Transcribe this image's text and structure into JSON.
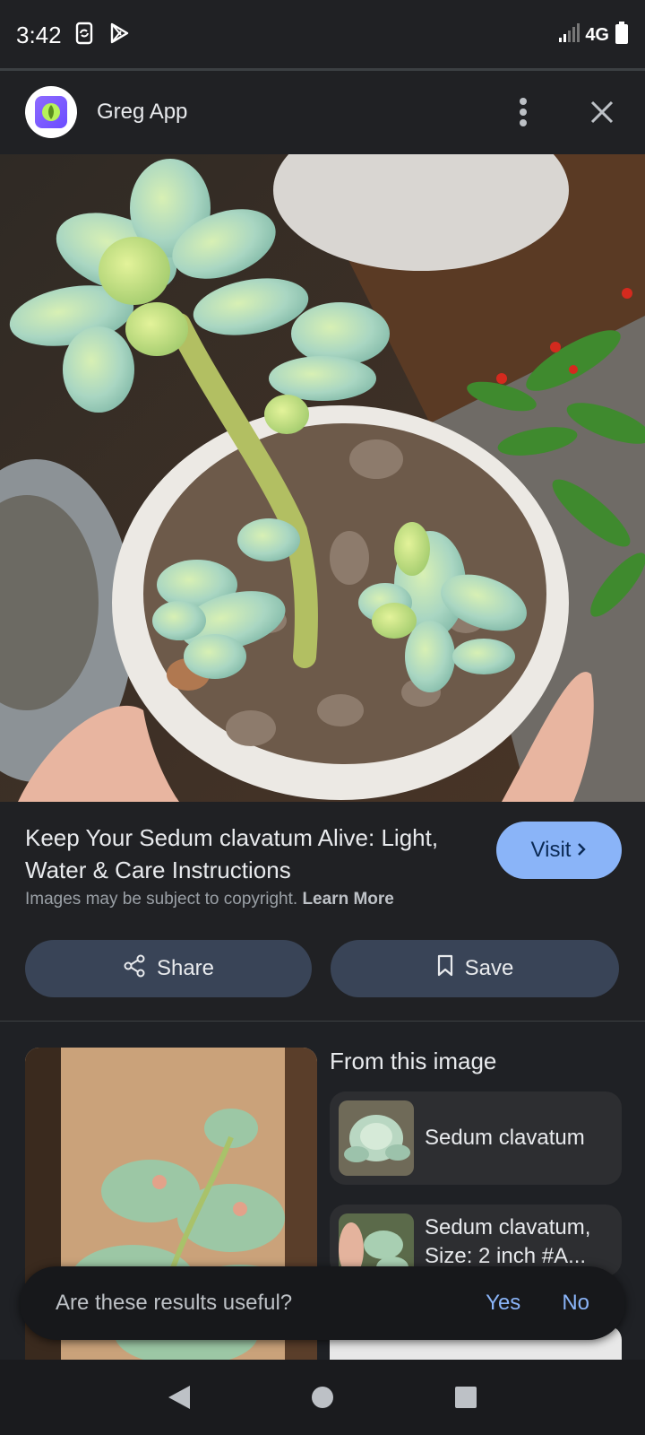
{
  "status_bar": {
    "time": "3:42",
    "network": "4G",
    "icons": [
      "sync-icon",
      "play-store-icon",
      "signal-icon",
      "battery-icon"
    ]
  },
  "header": {
    "app_name": "Greg App",
    "icons": [
      "greg-app-logo-icon",
      "more-vert-icon",
      "close-icon"
    ]
  },
  "result": {
    "title": "Keep Your Sedum clavatum Alive: Light, Water & Care Instructions",
    "visit_label": "Visit",
    "copyright_text": "Images may be subject to copyright.",
    "learn_more": "Learn More",
    "share_label": "Share",
    "save_label": "Save"
  },
  "from_image": {
    "heading": "From this image",
    "items": [
      {
        "label": "Sedum clavatum"
      },
      {
        "label": "Sedum clavatum, Size: 2 inch #A..."
      }
    ]
  },
  "feedback": {
    "question": "Are these results useful?",
    "yes": "Yes",
    "no": "No"
  },
  "nav": {
    "icons": [
      "back-icon",
      "home-icon",
      "recents-icon"
    ]
  },
  "colors": {
    "accent": "#8ab4f8",
    "pill_background": "#394457",
    "background": "#202124"
  }
}
